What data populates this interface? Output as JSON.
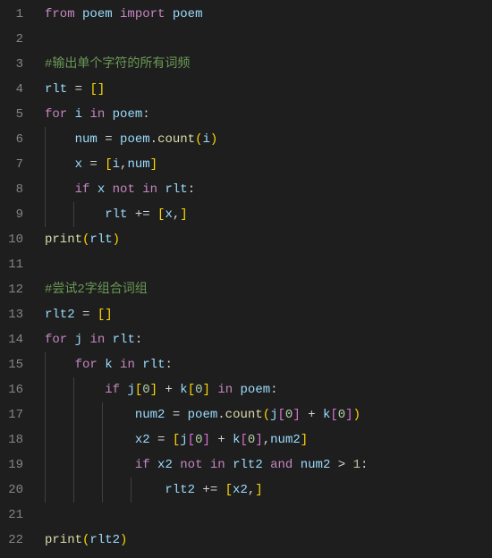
{
  "gutter": {
    "1": "1",
    "2": "2",
    "3": "3",
    "4": "4",
    "5": "5",
    "6": "6",
    "7": "7",
    "8": "8",
    "9": "9",
    "10": "10",
    "11": "11",
    "12": "12",
    "13": "13",
    "14": "14",
    "15": "15",
    "16": "16",
    "17": "17",
    "18": "18",
    "19": "19",
    "20": "20",
    "21": "21",
    "22": "22"
  },
  "t": {
    "from": "from",
    "import": "import",
    "for": "for",
    "in": "in",
    "if": "if",
    "not": "not",
    "and": "and",
    "poem": "poem",
    "rlt": "rlt",
    "rlt2": "rlt2",
    "i": "i",
    "j": "j",
    "k": "k",
    "x": "x",
    "x2": "x2",
    "num": "num",
    "num2": "num2",
    "count": "count",
    "print": "print",
    "eq": " = ",
    "pluseq": " += ",
    "plus": " + ",
    "colon": ":",
    "dot": ".",
    "comma": ",",
    "gt": " > ",
    "lparen": "(",
    "rparen": ")",
    "lbrack": "[",
    "rbrack": "]",
    "zero": "0",
    "one": "1",
    "cmt1": "#输出单个字符的所有词频",
    "cmt2": "#尝试2字组合词组",
    "sp1": " ",
    "sp4": "    ",
    "sp8": "        ",
    "sp12": "            ",
    "sp16": "                ",
    "sp20": "                    "
  }
}
